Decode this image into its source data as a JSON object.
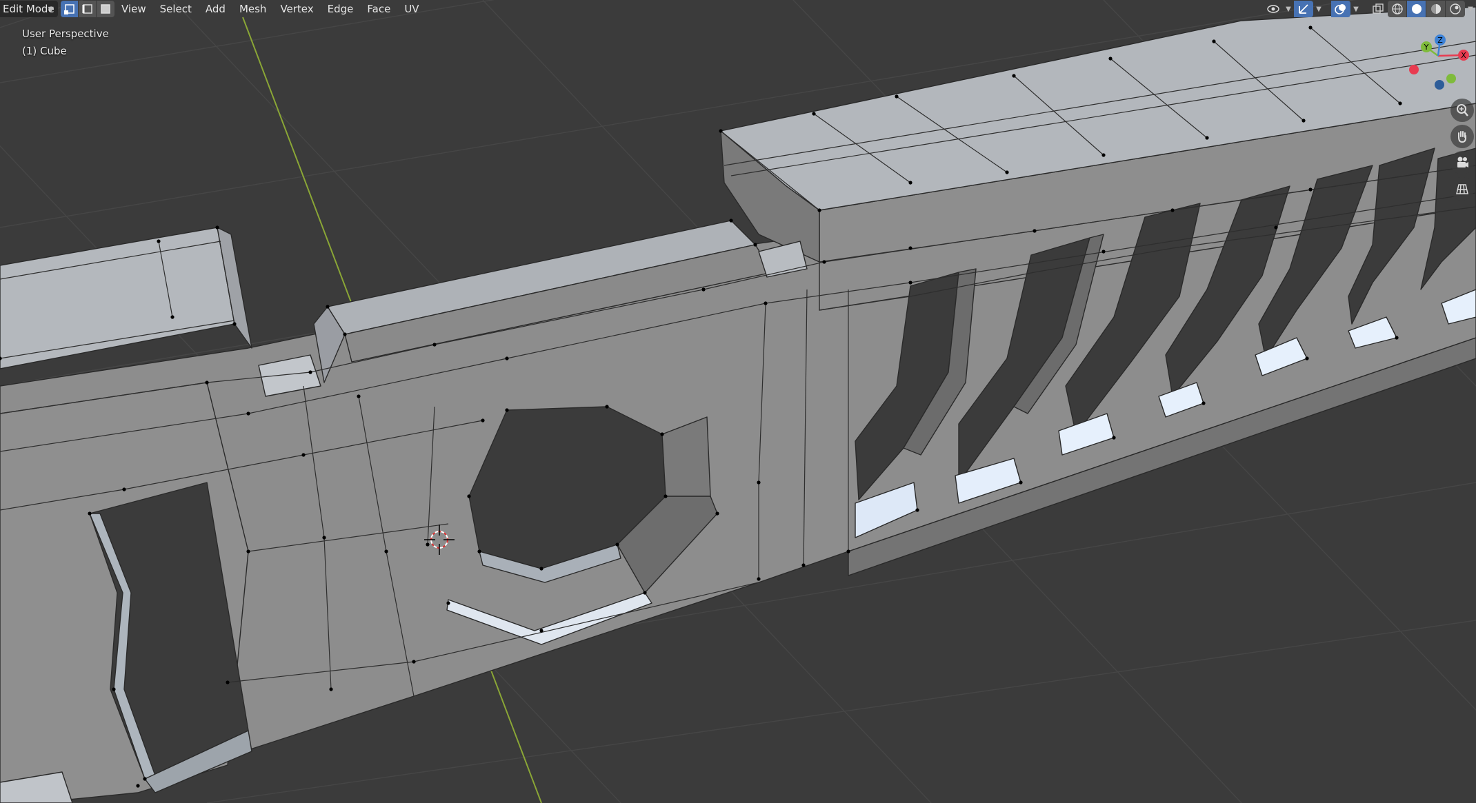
{
  "header": {
    "mode_label": "Edit Mode",
    "menu": [
      "View",
      "Select",
      "Add",
      "Mesh",
      "Vertex",
      "Edge",
      "Face",
      "UV"
    ]
  },
  "viewport": {
    "perspective_label": "User Perspective",
    "object_label": "(1) Cube"
  },
  "gizmo": {
    "axes": {
      "x": "X",
      "y": "Y",
      "z": "Z"
    },
    "colors": {
      "x": "#e83b50",
      "y": "#7fbb3b",
      "z": "#3d82d6"
    }
  },
  "icons": {
    "select_modes": [
      "vertex-select-icon",
      "edge-select-icon",
      "face-select-icon"
    ],
    "right_tools": [
      "visibility-icon",
      "gizmo-icon",
      "overlay-icon",
      "xray-icon",
      "wireframe-shading-icon",
      "solid-shading-icon",
      "material-shading-icon",
      "rendered-shading-icon"
    ],
    "nav": [
      "zoom-icon",
      "pan-hand-icon",
      "camera-icon",
      "grid-ortho-icon"
    ]
  },
  "colors": {
    "background": "#3b3b3b",
    "mesh_face": "#8f8f8f",
    "mesh_top": "#b5b9bf",
    "mesh_dark": "#6e6e6e",
    "active_blue": "#4772b3",
    "x_axis_line": "#b3404a",
    "y_axis_line": "#8aa636"
  }
}
